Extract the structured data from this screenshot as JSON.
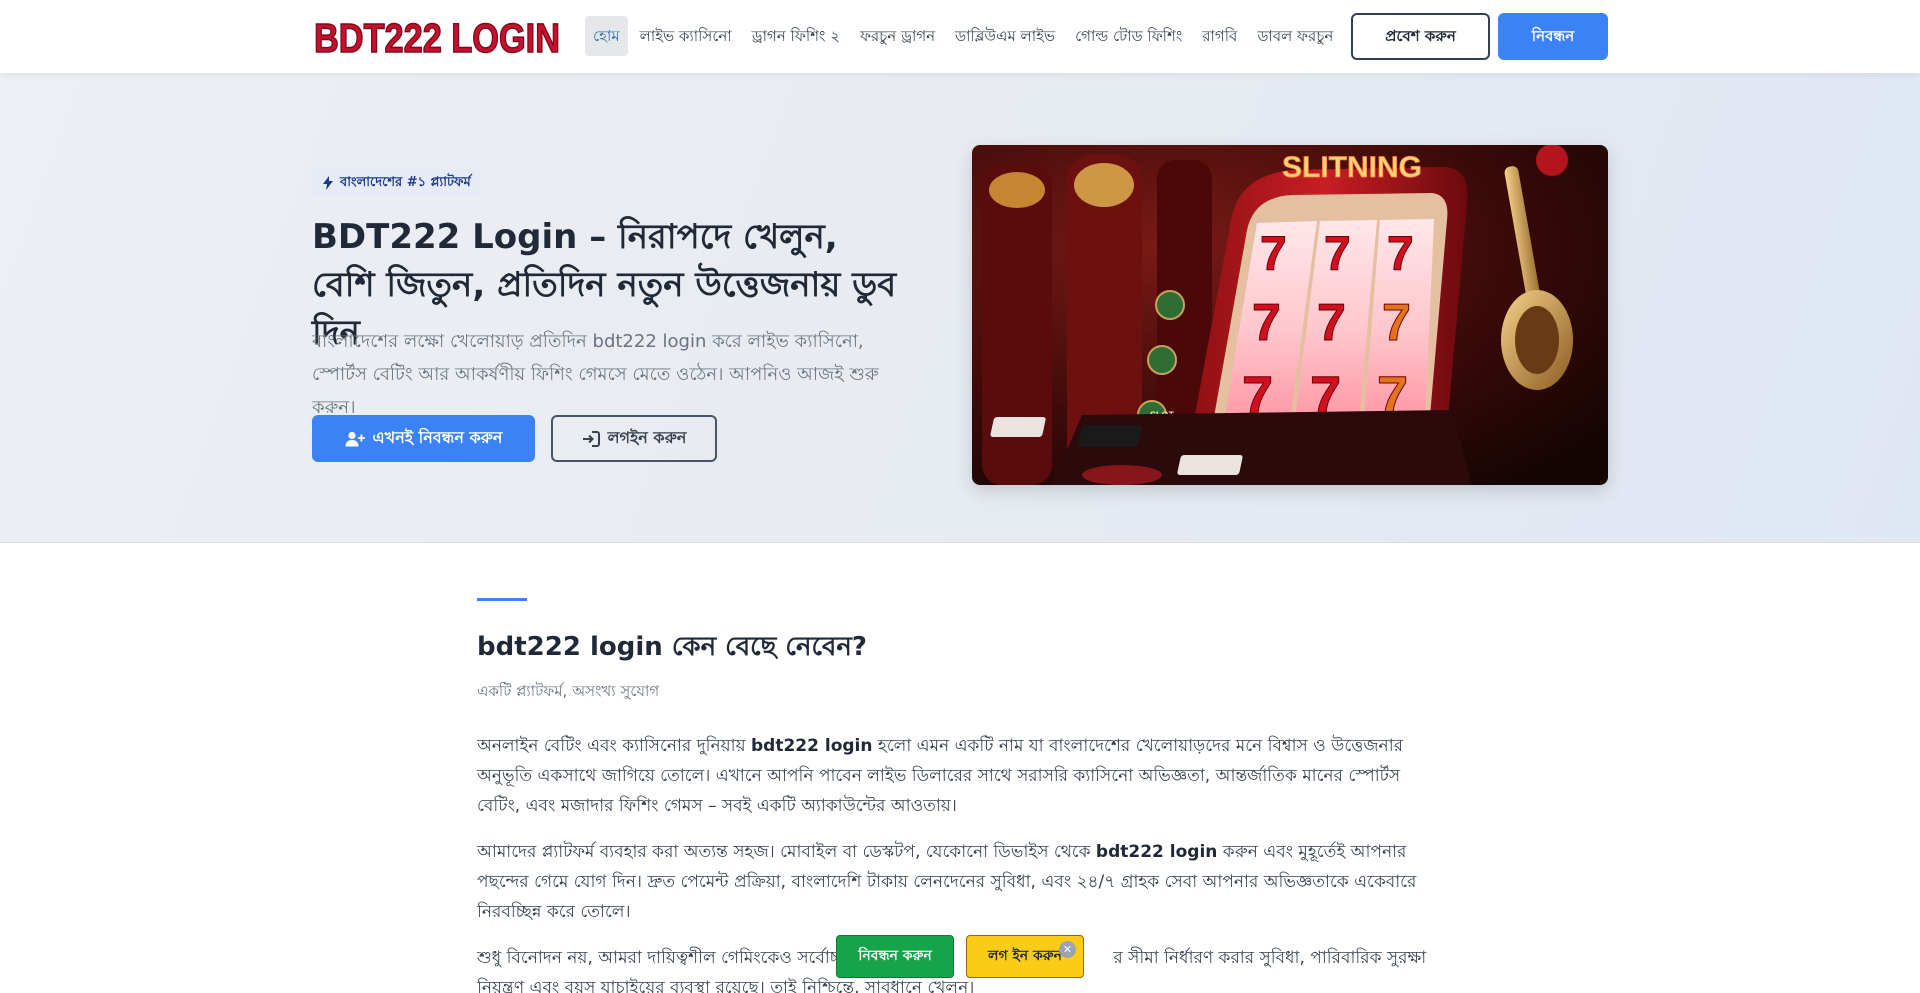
{
  "header": {
    "logo_text": "BDT222 LOGIN",
    "nav": [
      {
        "label": "হোম",
        "active": true
      },
      {
        "label": "লাইভ ক্যাসিনো"
      },
      {
        "label": "ড্রাগন ফিশিং ২"
      },
      {
        "label": "ফরচুন ড্রাগন"
      },
      {
        "label": "ডাব্লিউএম লাইভ"
      },
      {
        "label": "গোল্ড টোড ফিশিং"
      },
      {
        "label": "রাগবি"
      },
      {
        "label": "ডাবল ফরচুন"
      }
    ],
    "login_label": "প্রবেশ করুন",
    "register_label": "নিবন্ধন"
  },
  "hero": {
    "badge": "বাংলাদেশের #১ প্ল্যাটফর্ম",
    "title": "BDT222 Login – নিরাপদে খেলুন, বেশি জিতুন, প্রতিদিন নতুন উত্তেজনায় ডুব দিন",
    "subtitle": "বাংলাদেশের লক্ষো খেলোয়াড় প্রতিদিন bdt222 login করে লাইভ ক্যাসিনো, স্পোর্টস বেটিং আর আকর্ষণীয় ফিশিং গেমসে মেতে ওঠেন। আপনিও আজই শুরু করুন।",
    "primary_button": "এখনই নিবন্ধন করুন",
    "secondary_button": "লগইন করুন",
    "image_sign": "SLITNING",
    "image_slot_label": "SLOT"
  },
  "section": {
    "title": "bdt222 login কেন বেছে নেবেন?",
    "subtitle": "একটি প্ল্যাটফর্ম, অসংখ্য সুযোগ",
    "p1_a": "অনলাইন বেটিং এবং ক্যাসিনোর দুনিয়ায় ",
    "p1_b": "bdt222 login",
    "p1_c": " হলো এমন একটি নাম যা বাংলাদেশের খেলোয়াড়দের মনে বিশ্বাস ও উত্তেজনার অনুভূতি একসাথে জাগিয়ে তোলে। এখানে আপনি পাবেন লাইভ ডিলারের সাথে সরাসরি ক্যাসিনো অভিজ্ঞতা, আন্তর্জাতিক মানের স্পোর্টস বেটিং, এবং মজাদার ফিশিং গেমস – সবই একটি অ্যাকাউন্টের আওতায়।",
    "p2_a": "আমাদের প্ল্যাটফর্ম ব্যবহার করা অত্যন্ত সহজ। মোবাইল বা ডেস্কটপ, যেকোনো ডিভাইস থেকে ",
    "p2_b": "bdt222 login",
    "p2_c": " করুন এবং মুহূর্তেই আপনার পছন্দের গেমে যোগ দিন। দ্রুত পেমেন্ট প্রক্রিয়া, বাংলাদেশি টাকায় লেনদেনের সুবিধা, এবং ২৪/৭ গ্রাহক সেবা আপনার অভিজ্ঞতাকে একেবারে নিরবচ্ছিন্ন করে তোলে।",
    "p3_a": "শুধু বিনোদন নয়, আমরা দায়িত্বশীল গেমিংকেও সর্বোচ্চ",
    "p3_b": "র সীমা নির্ধারণ করার সুবিধা, পারিবারিক সুরক্ষা নিয়ন্ত্রণ এবং বয়স যাচাইয়ের ব্যবস্থা রয়েছে। তাই নিশ্চিন্তে, সাবধানে খেলুন।"
  },
  "floating": {
    "register_label": "নিবন্ধন করুন",
    "login_label": "লগ ইন করুন",
    "close_glyph": "✕"
  },
  "colors": {
    "brand_red": "#c8102e",
    "primary_blue": "#3b82f6",
    "float_green": "#16a34a",
    "float_yellow": "#facc15"
  }
}
